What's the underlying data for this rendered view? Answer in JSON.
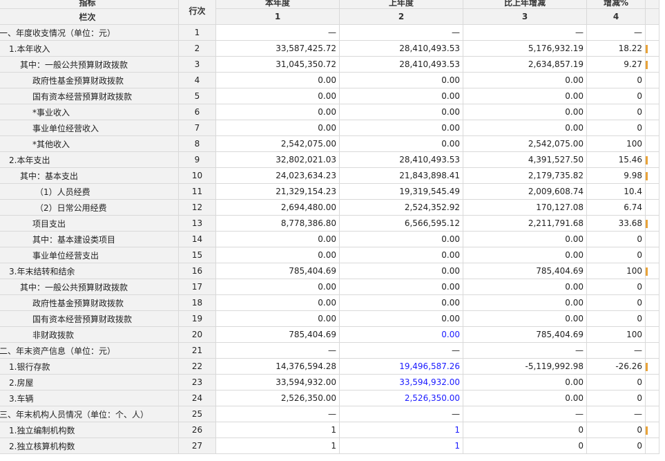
{
  "header": {
    "indicator": "指标",
    "column_label": "栏次",
    "line_no": "行次",
    "this_year": "本年度",
    "last_year": "上年度",
    "change": "比上年增减",
    "change_pct": "增减%",
    "col1": "1",
    "col2": "2",
    "col3": "3",
    "col4": "4"
  },
  "rows": [
    {
      "name": "一、年度收支情况（单位：元）",
      "line": "1",
      "v1": "—",
      "v2": "—",
      "v3": "—",
      "v4": "—",
      "ind": "ind0"
    },
    {
      "name": "1.本年收入",
      "line": "2",
      "v1": "33,587,425.72",
      "v2": "28,410,493.53",
      "v3": "5,176,932.19",
      "v4": "18.22",
      "ind": "ind1"
    },
    {
      "name": "其中：一般公共预算财政拨款",
      "line": "3",
      "v1": "31,045,350.72",
      "v2": "28,410,493.53",
      "v3": "2,634,857.19",
      "v4": "9.27",
      "ind": "ind2"
    },
    {
      "name": "政府性基金预算财政拨款",
      "line": "4",
      "v1": "0.00",
      "v2": "0.00",
      "v3": "0.00",
      "v4": "0",
      "ind": "ind3"
    },
    {
      "name": "国有资本经营预算财政拨款",
      "line": "5",
      "v1": "0.00",
      "v2": "0.00",
      "v3": "0.00",
      "v4": "0",
      "ind": "ind3"
    },
    {
      "name": "*事业收入",
      "line": "6",
      "v1": "0.00",
      "v2": "0.00",
      "v3": "0.00",
      "v4": "0",
      "ind": "ind3"
    },
    {
      "name": "事业单位经营收入",
      "line": "7",
      "v1": "0.00",
      "v2": "0.00",
      "v3": "0.00",
      "v4": "0",
      "ind": "ind3"
    },
    {
      "name": "*其他收入",
      "line": "8",
      "v1": "2,542,075.00",
      "v2": "0.00",
      "v3": "2,542,075.00",
      "v4": "100",
      "ind": "ind3"
    },
    {
      "name": "2.本年支出",
      "line": "9",
      "v1": "32,802,021.03",
      "v2": "28,410,493.53",
      "v3": "4,391,527.50",
      "v4": "15.46",
      "ind": "ind1"
    },
    {
      "name": "其中：基本支出",
      "line": "10",
      "v1": "24,023,634.23",
      "v2": "21,843,898.41",
      "v3": "2,179,735.82",
      "v4": "9.98",
      "ind": "ind2"
    },
    {
      "name": "（1）人员经费",
      "line": "11",
      "v1": "21,329,154.23",
      "v2": "19,319,545.49",
      "v3": "2,009,608.74",
      "v4": "10.4",
      "ind": "ind4"
    },
    {
      "name": "（2）日常公用经费",
      "line": "12",
      "v1": "2,694,480.00",
      "v2": "2,524,352.92",
      "v3": "170,127.08",
      "v4": "6.74",
      "ind": "ind4"
    },
    {
      "name": "项目支出",
      "line": "13",
      "v1": "8,778,386.80",
      "v2": "6,566,595.12",
      "v3": "2,211,791.68",
      "v4": "33.68",
      "ind": "ind3"
    },
    {
      "name": "其中：基本建设类项目",
      "line": "14",
      "v1": "0.00",
      "v2": "0.00",
      "v3": "0.00",
      "v4": "0",
      "ind": "ind3"
    },
    {
      "name": "事业单位经营支出",
      "line": "15",
      "v1": "0.00",
      "v2": "0.00",
      "v3": "0.00",
      "v4": "0",
      "ind": "ind3"
    },
    {
      "name": "3.年末结转和结余",
      "line": "16",
      "v1": "785,404.69",
      "v2": "0.00",
      "v3": "785,404.69",
      "v4": "100",
      "ind": "ind1"
    },
    {
      "name": "其中：一般公共预算财政拨款",
      "line": "17",
      "v1": "0.00",
      "v2": "0.00",
      "v3": "0.00",
      "v4": "0",
      "ind": "ind2"
    },
    {
      "name": "政府性基金预算财政拨款",
      "line": "18",
      "v1": "0.00",
      "v2": "0.00",
      "v3": "0.00",
      "v4": "0",
      "ind": "ind3"
    },
    {
      "name": "国有资本经营预算财政拨款",
      "line": "19",
      "v1": "0.00",
      "v2": "0.00",
      "v3": "0.00",
      "v4": "0",
      "ind": "ind3"
    },
    {
      "name": "非财政拨款",
      "line": "20",
      "v1": "785,404.69",
      "v2": "0.00",
      "v3": "785,404.69",
      "v4": "100",
      "ind": "ind3",
      "v2blue": true
    },
    {
      "name": "二、年末资产信息（单位：元）",
      "line": "21",
      "v1": "—",
      "v2": "—",
      "v3": "—",
      "v4": "—",
      "ind": "ind0"
    },
    {
      "name": "1.银行存款",
      "line": "22",
      "v1": "14,376,594.28",
      "v2": "19,496,587.26",
      "v3": "-5,119,992.98",
      "v4": "-26.26",
      "ind": "ind1",
      "v2blue": true
    },
    {
      "name": "2.房屋",
      "line": "23",
      "v1": "33,594,932.00",
      "v2": "33,594,932.00",
      "v3": "0.00",
      "v4": "0",
      "ind": "ind1",
      "v2blue": true
    },
    {
      "name": "3.车辆",
      "line": "24",
      "v1": "2,526,350.00",
      "v2": "2,526,350.00",
      "v3": "0.00",
      "v4": "0",
      "ind": "ind1",
      "v2blue": true
    },
    {
      "name": "三、年末机构人员情况（单位：个、人）",
      "line": "25",
      "v1": "—",
      "v2": "—",
      "v3": "—",
      "v4": "—",
      "ind": "ind0"
    },
    {
      "name": "1.独立编制机构数",
      "line": "26",
      "v1": "1",
      "v2": "1",
      "v3": "0",
      "v4": "0",
      "ind": "ind1",
      "v2blue": true
    },
    {
      "name": "2.独立核算机构数",
      "line": "27",
      "v1": "1",
      "v2": "1",
      "v3": "0",
      "v4": "0",
      "ind": "ind1",
      "v2blue": true
    }
  ]
}
